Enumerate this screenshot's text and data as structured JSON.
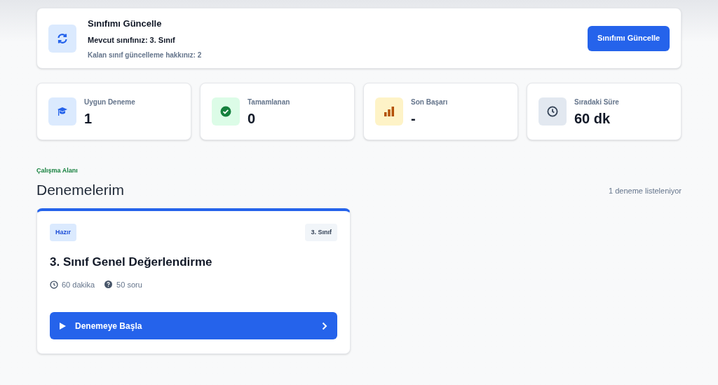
{
  "class_card": {
    "title": "Sınıfımı Güncelle",
    "current": "Mevcut sınıfınız: 3. Sınıf",
    "remaining": "Kalan sınıf güncelleme hakkınız: 2",
    "button": "Sınıfımı Güncelle"
  },
  "stats": [
    {
      "kind": "exams",
      "label": "Uygun Deneme",
      "value": "1"
    },
    {
      "kind": "completed",
      "label": "Tamamlanan",
      "value": "0"
    },
    {
      "kind": "success",
      "label": "Son Başarı",
      "value": "-"
    },
    {
      "kind": "time",
      "label": "Sıradaki Süre",
      "value": "60 dk"
    }
  ],
  "section": {
    "eyebrow": "Çalışma Alanı",
    "title": "Denemelerim",
    "count": "1 deneme listeleniyor"
  },
  "exams": [
    {
      "status": "Hazır",
      "grade": "3. Sınıf",
      "title": "3. Sınıf Genel Değerlendirme",
      "duration": "60 dakika",
      "questions": "50 soru",
      "button": "Denemeye Başla"
    }
  ]
}
